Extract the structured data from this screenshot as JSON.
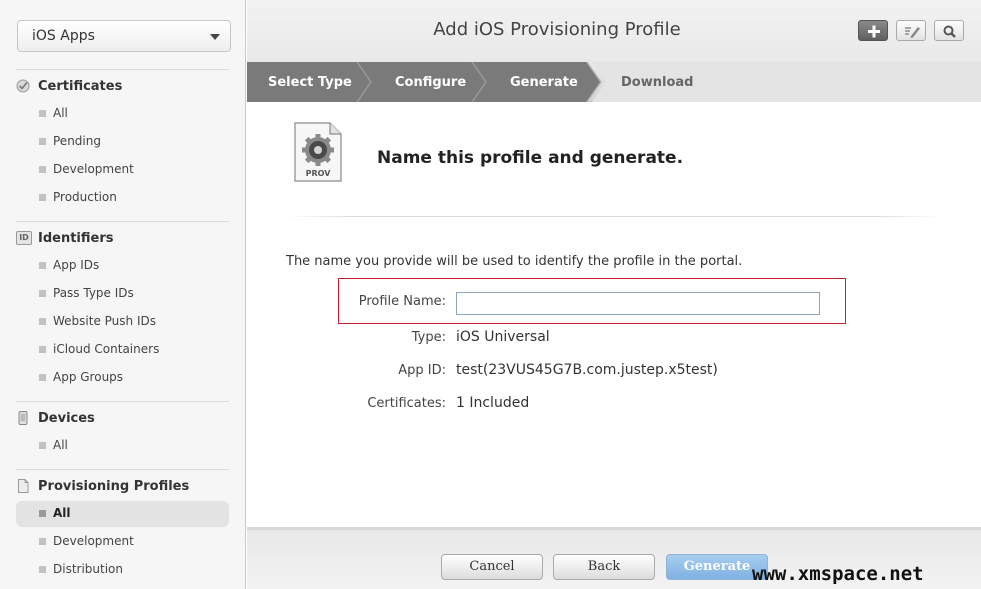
{
  "sidebar": {
    "app_selector": "iOS Apps",
    "sections": [
      {
        "title": "Certificates",
        "icon": "certificate-icon",
        "items": [
          "All",
          "Pending",
          "Development",
          "Production"
        ]
      },
      {
        "title": "Identifiers",
        "icon": "id-icon",
        "items": [
          "App IDs",
          "Pass Type IDs",
          "Website Push IDs",
          "iCloud Containers",
          "App Groups"
        ]
      },
      {
        "title": "Devices",
        "icon": "device-icon",
        "items": [
          "All"
        ]
      },
      {
        "title": "Provisioning Profiles",
        "icon": "document-icon",
        "items": [
          "All",
          "Development",
          "Distribution"
        ],
        "active_item": "All"
      }
    ],
    "id_icon_text": "ID"
  },
  "header": {
    "title": "Add iOS Provisioning Profile",
    "toolbar": [
      "plus-icon",
      "edit-icon",
      "search-icon"
    ]
  },
  "steps": [
    {
      "label": "Select Type",
      "state": "done"
    },
    {
      "label": "Configure",
      "state": "done"
    },
    {
      "label": "Generate",
      "state": "current"
    },
    {
      "label": "Download",
      "state": "upcoming"
    }
  ],
  "main": {
    "icon_label": "PROV",
    "headline": "Name this profile and generate.",
    "description": "The name you provide will be used to identify the profile in the portal.",
    "profile_name": {
      "label": "Profile Name:",
      "value": "",
      "placeholder": ""
    },
    "fields": [
      {
        "label": "Type:",
        "value": "iOS Universal"
      },
      {
        "label": "App ID:",
        "value": "test(23VUS45G7B.com.justep.x5test)"
      },
      {
        "label": "Certificates:",
        "value": "1 Included"
      }
    ]
  },
  "footer": {
    "cancel": "Cancel",
    "back": "Back",
    "generate": "Generate"
  },
  "watermark": "www.xmspace.net",
  "colors": {
    "highlight_border": "#c8202a",
    "generate_button": "#8fbce8",
    "step_active": "#777777",
    "step_upcoming": "#e0e0e0"
  }
}
